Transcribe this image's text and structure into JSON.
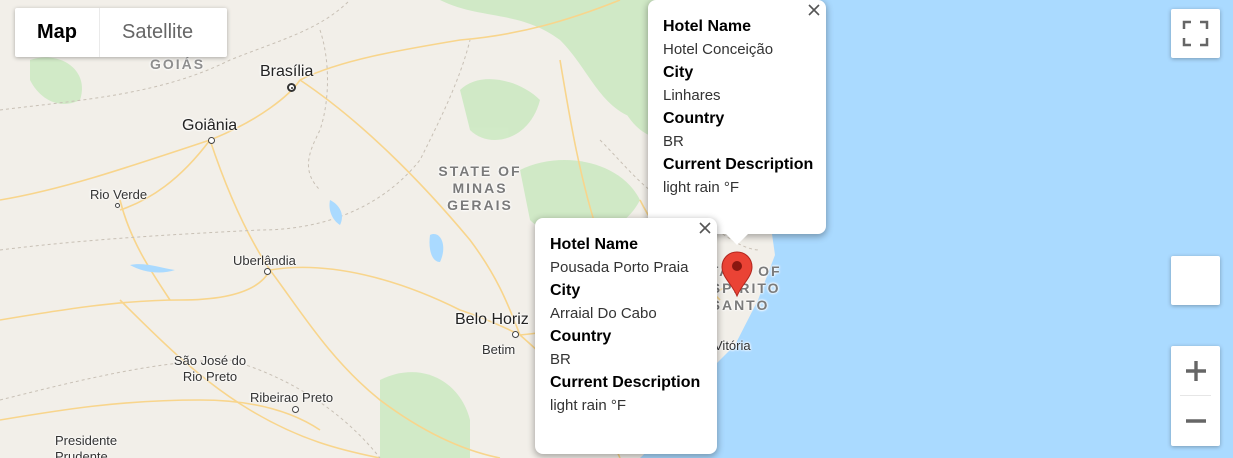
{
  "map_type": {
    "map_label": "Map",
    "satellite_label": "Satellite"
  },
  "places": {
    "goias": "GOIÁS",
    "brasilia": "Brasília",
    "goiania": "Goiânia",
    "rio_verde": "Rio Verde",
    "uberlandia": "Uberlândia",
    "sao_jose": "São José do Rio Preto",
    "ribeirao_preto": "Ribeirao Preto",
    "presidente": "Presidente Prudente",
    "minas_gerais": "STATE OF MINAS GERAIS",
    "belo_horizonte": "Belo Horiz",
    "betim": "Betim",
    "espirito_santo": "STATE OF ESPÍRITO SANTO",
    "vitoria": "Vitória"
  },
  "info_windows": [
    {
      "fields": [
        {
          "label": "Hotel Name",
          "value": "Hotel Conceição"
        },
        {
          "label": "City",
          "value": "Linhares"
        },
        {
          "label": "Country",
          "value": "BR"
        },
        {
          "label": "Current Description",
          "value": "light rain °F"
        }
      ]
    },
    {
      "fields": [
        {
          "label": "Hotel Name",
          "value": "Pousada Porto Praia"
        },
        {
          "label": "City",
          "value": "Arraial Do Cabo"
        },
        {
          "label": "Country",
          "value": "BR"
        },
        {
          "label": "Current Description",
          "value": "light rain °F"
        }
      ]
    }
  ],
  "icons": {
    "fullscreen": "fullscreen-icon",
    "zoom_in": "plus-icon",
    "zoom_out": "minus-icon",
    "close": "close-icon",
    "marker": "map-pin-icon"
  },
  "colors": {
    "land": "#f2efe9",
    "water": "#aadaff",
    "park": "#cde9c3",
    "road": "#f8d58c",
    "marker": "#ea4335"
  }
}
